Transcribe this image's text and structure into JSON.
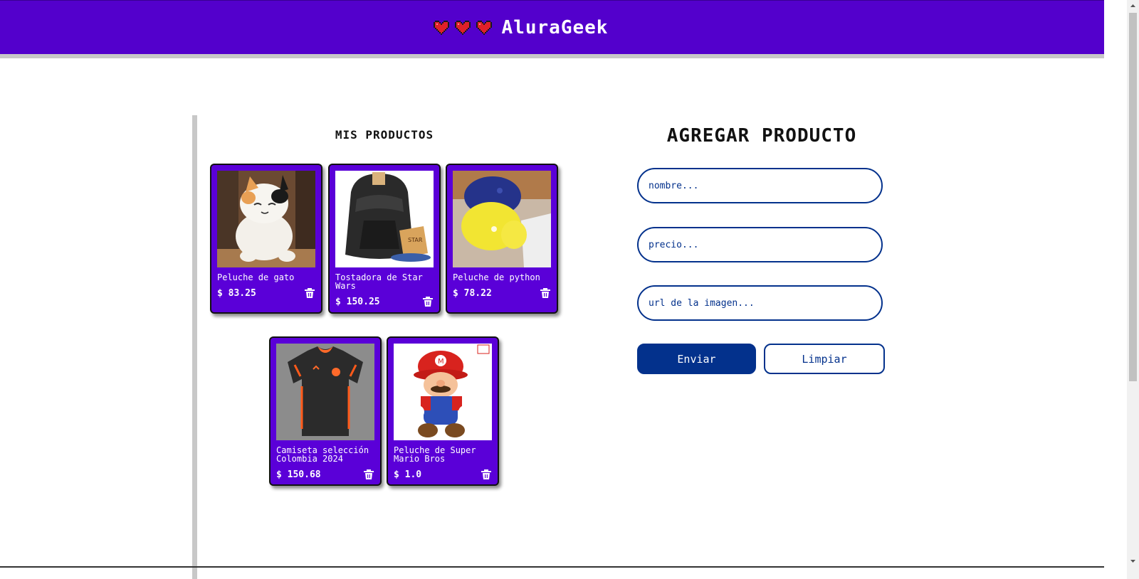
{
  "header": {
    "title": "AluraGeek",
    "hearts": [
      "heart-icon",
      "heart-icon",
      "heart-icon"
    ],
    "color": "#5300cc"
  },
  "products": {
    "title": "MIS PRODUCTOS",
    "items": [
      {
        "name": "Peluche de gato",
        "price": "$ 83.25",
        "image": "cat-plush-image"
      },
      {
        "name": "Tostadora de Star Wars",
        "price": "$ 150.25",
        "image": "darth-vader-toaster-image"
      },
      {
        "name": "Peluche de python",
        "price": "$ 78.22",
        "image": "python-plush-image"
      },
      {
        "name": "Camiseta selección Colombia 2024",
        "price": "$ 150.68",
        "image": "colombia-jersey-image"
      },
      {
        "name": "Peluche de Super Mario Bros",
        "price": "$ 1.0",
        "image": "mario-plush-image"
      }
    ]
  },
  "form": {
    "title": "AGREGAR PRODUCTO",
    "name_placeholder": "nombre...",
    "price_placeholder": "precio...",
    "url_placeholder": "url de la imagen...",
    "send_label": "Enviar",
    "clear_label": "Limpiar",
    "accent": "#03318c"
  }
}
